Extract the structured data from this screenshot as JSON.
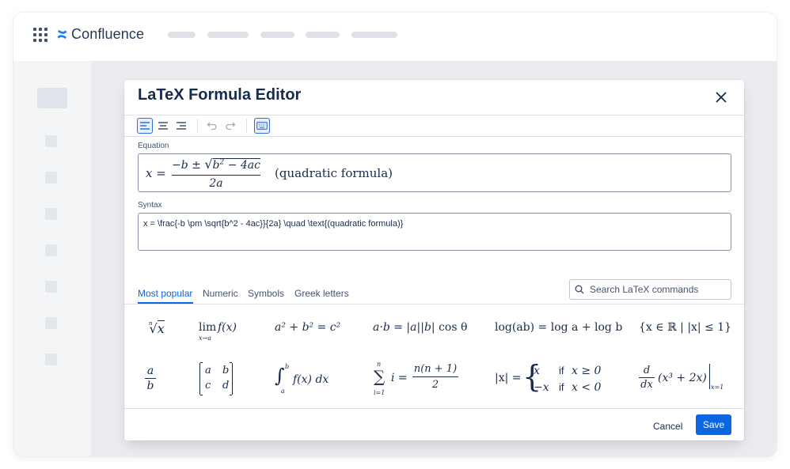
{
  "app": {
    "name": "Confluence"
  },
  "dialog": {
    "title": "LaTeX Formula Editor",
    "equation_label": "Equation",
    "syntax_label": "Syntax",
    "syntax_value": "x = \\frac{-b \\pm \\sqrt{b^2 - 4ac}}{2a} \\quad \\text{(quadratic formula)}",
    "equation_preview": {
      "lhs": "x =",
      "numerator": "−b ±",
      "radicand_base": "b",
      "radicand_exp": "2",
      "radicand_rest": "− 4ac",
      "denominator": "2a",
      "note": "(quadratic formula)"
    }
  },
  "tabs": [
    {
      "label": "Most popular"
    },
    {
      "label": "Numeric"
    },
    {
      "label": "Symbols"
    },
    {
      "label": "Greek letters"
    }
  ],
  "search": {
    "placeholder": "Search LaTeX commands"
  },
  "formulas": {
    "f_sqrt": {
      "index": "n",
      "body": "x"
    },
    "f_lim": {
      "op": "lim",
      "sub": "x→a",
      "body": "f(x)"
    },
    "f_pyth": {
      "text": "a² + b² = c²"
    },
    "f_dot": {
      "a": "a",
      "b": "b",
      "eq": "=",
      "rhs_tail": "cos θ"
    },
    "f_log": {
      "text": "log(ab) = log a + log b"
    },
    "f_set": {
      "text": "{x ∈ ℝ | |x| ≤ 1}"
    },
    "f_frac": {
      "num": "a",
      "den": "b"
    },
    "f_matrix": {
      "a": "a",
      "b": "b",
      "c": "c",
      "d": "d"
    },
    "f_integral": {
      "upper": "b",
      "lower": "a",
      "body": "f(x) dx"
    },
    "f_sum": {
      "upper": "n",
      "lower": "i=1",
      "body": "i =",
      "num": "n(n + 1)",
      "den": "2"
    },
    "f_abs": {
      "lhs": "|x| =",
      "row1_val": "x",
      "row1_cond": "if",
      "row1_expr": "x ≥ 0",
      "row2_val": "−x",
      "row2_cond": "if",
      "row2_expr": "x < 0"
    },
    "f_deriv": {
      "num": "d",
      "den": "dx",
      "body": "(x³ + 2x)",
      "eval": "x=1"
    }
  },
  "actions": {
    "cancel_label": "Cancel",
    "save_label": "Save"
  },
  "colors": {
    "brand": "#0c66e4",
    "text": "#172b4d"
  }
}
